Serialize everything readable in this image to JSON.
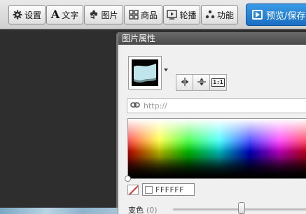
{
  "toolbar": {
    "items": [
      {
        "label": "设置",
        "icon": "gear-icon"
      },
      {
        "label": "文字",
        "icon": "text-a-icon",
        "glyph": "A"
      },
      {
        "label": "图片",
        "icon": "flower-icon"
      },
      {
        "label": "商品",
        "icon": "grid-icon"
      },
      {
        "label": "轮播",
        "icon": "slideshow-icon"
      },
      {
        "label": "功能",
        "icon": "dots-cluster-icon"
      }
    ],
    "preview_label": "预览/保存"
  },
  "panel": {
    "title": "图片属性",
    "thumbnail_icon": "image-thumbnail",
    "tools": [
      {
        "icon": "flip-horizontal-icon"
      },
      {
        "icon": "flip-vertical-icon"
      },
      {
        "icon": "original-size-icon",
        "glyph": "1:1"
      }
    ],
    "url_placeholder": "http://",
    "url_icon": "link-icon",
    "color_hex": "FFFFFF",
    "slider_label": "变色",
    "slider_value": "(0)",
    "slider_position": 0.5
  },
  "colors": {
    "preview_accent": "#1a6fc2",
    "panel_bg": "#f0f0f0",
    "title_bar": "#4a4a4a"
  }
}
